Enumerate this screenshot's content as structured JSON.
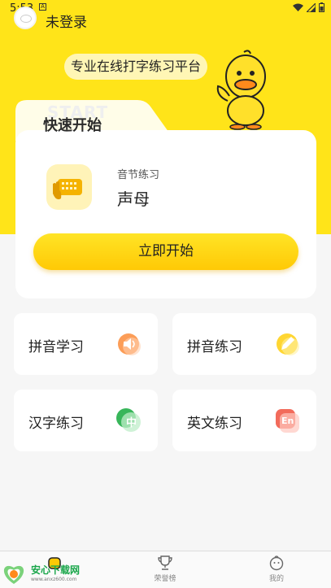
{
  "status_bar": {
    "time": "5:53",
    "notification": "A"
  },
  "header": {
    "login_label": "未登录"
  },
  "banner": {
    "slogan": "专业在线打字练习平台"
  },
  "quick_start": {
    "watermark": "START",
    "title": "快速开始",
    "lesson_category": "音节练习",
    "lesson_name": "声母",
    "start_label": "立即开始"
  },
  "tiles": [
    {
      "label": "拼音学习",
      "icon": "speaker-icon",
      "color": "#fb8c3a"
    },
    {
      "label": "拼音练习",
      "icon": "pencil-icon",
      "color": "#ffd11c"
    },
    {
      "label": "汉字练习",
      "icon": "zhong-icon",
      "icon_text": "中",
      "color": "#4cc16a"
    },
    {
      "label": "英文练习",
      "icon": "en-icon",
      "icon_text": "En",
      "color": "#f26b5b"
    }
  ],
  "bottom_nav": [
    {
      "label": "",
      "icon": "home-icon"
    },
    {
      "label": "荣誉榜",
      "icon": "trophy-icon"
    },
    {
      "label": "我的",
      "icon": "profile-icon"
    }
  ],
  "watermark": {
    "name": "安心下载网",
    "url": "www.anxz600.com",
    "logo_text": "安心 众网"
  },
  "colors": {
    "brand_yellow": "#ffe419",
    "button_yellow": "#ffc905",
    "background": "#f6f6f6"
  }
}
